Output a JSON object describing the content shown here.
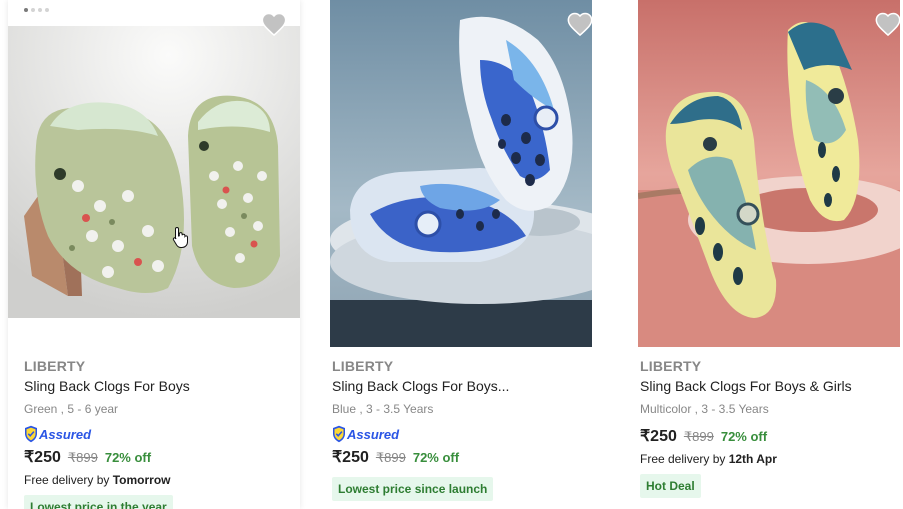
{
  "products": [
    {
      "brand": "LIBERTY",
      "title": "Sling Back Clogs For Boys",
      "variant": "Green , 5 - 6 year",
      "assured": "Assured",
      "price": "₹250",
      "mrp": "₹899",
      "discount": "72% off",
      "delivery_prefix": "Free delivery by ",
      "delivery_date": "Tomorrow",
      "tag": "Lowest price in the year",
      "image": "green-clogs-image",
      "carousel_dots": 4,
      "active_dot": 1
    },
    {
      "brand": "LIBERTY",
      "title": "Sling Back Clogs For Boys...",
      "variant": "Blue , 3 - 3.5 Years",
      "assured": "Assured",
      "price": "₹250",
      "mrp": "₹899",
      "discount": "72% off",
      "tag": "Lowest price since launch",
      "image": "blue-clogs-image"
    },
    {
      "brand": "LIBERTY",
      "title": "Sling Back Clogs For Boys & Girls",
      "variant": "Multicolor , 3 - 3.5 Years",
      "price": "₹250",
      "mrp": "₹899",
      "discount": "72% off",
      "delivery_prefix": "Free delivery by ",
      "delivery_date": "12th Apr",
      "tag": "Hot Deal",
      "image": "multicolor-clogs-image"
    }
  ],
  "colors": {
    "brand_text": "#878787",
    "discount": "#388e3c",
    "assured": "#2a55e5",
    "tag_bg": "#e6f7ec"
  },
  "icons": {
    "wishlist": "heart-icon",
    "assured": "shield-icon",
    "cursor": "hand-pointer-icon"
  }
}
